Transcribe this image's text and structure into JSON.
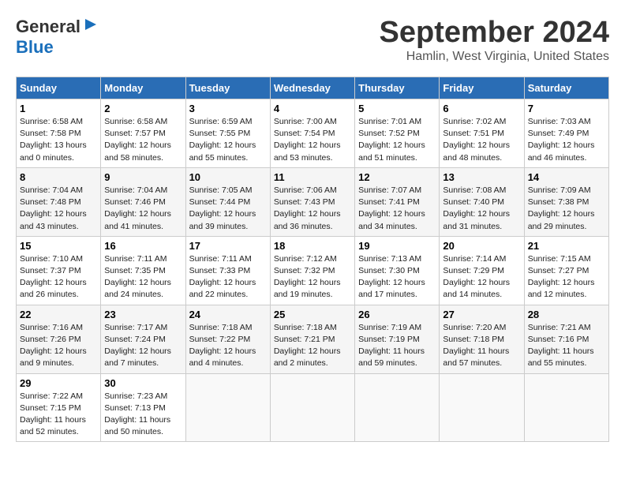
{
  "header": {
    "logo_general": "General",
    "logo_blue": "Blue",
    "month_title": "September 2024",
    "location": "Hamlin, West Virginia, United States"
  },
  "weekdays": [
    "Sunday",
    "Monday",
    "Tuesday",
    "Wednesday",
    "Thursday",
    "Friday",
    "Saturday"
  ],
  "weeks": [
    [
      {
        "day": "1",
        "lines": [
          "Sunrise: 6:58 AM",
          "Sunset: 7:58 PM",
          "Daylight: 13 hours",
          "and 0 minutes."
        ]
      },
      {
        "day": "2",
        "lines": [
          "Sunrise: 6:58 AM",
          "Sunset: 7:57 PM",
          "Daylight: 12 hours",
          "and 58 minutes."
        ]
      },
      {
        "day": "3",
        "lines": [
          "Sunrise: 6:59 AM",
          "Sunset: 7:55 PM",
          "Daylight: 12 hours",
          "and 55 minutes."
        ]
      },
      {
        "day": "4",
        "lines": [
          "Sunrise: 7:00 AM",
          "Sunset: 7:54 PM",
          "Daylight: 12 hours",
          "and 53 minutes."
        ]
      },
      {
        "day": "5",
        "lines": [
          "Sunrise: 7:01 AM",
          "Sunset: 7:52 PM",
          "Daylight: 12 hours",
          "and 51 minutes."
        ]
      },
      {
        "day": "6",
        "lines": [
          "Sunrise: 7:02 AM",
          "Sunset: 7:51 PM",
          "Daylight: 12 hours",
          "and 48 minutes."
        ]
      },
      {
        "day": "7",
        "lines": [
          "Sunrise: 7:03 AM",
          "Sunset: 7:49 PM",
          "Daylight: 12 hours",
          "and 46 minutes."
        ]
      }
    ],
    [
      {
        "day": "8",
        "lines": [
          "Sunrise: 7:04 AM",
          "Sunset: 7:48 PM",
          "Daylight: 12 hours",
          "and 43 minutes."
        ]
      },
      {
        "day": "9",
        "lines": [
          "Sunrise: 7:04 AM",
          "Sunset: 7:46 PM",
          "Daylight: 12 hours",
          "and 41 minutes."
        ]
      },
      {
        "day": "10",
        "lines": [
          "Sunrise: 7:05 AM",
          "Sunset: 7:44 PM",
          "Daylight: 12 hours",
          "and 39 minutes."
        ]
      },
      {
        "day": "11",
        "lines": [
          "Sunrise: 7:06 AM",
          "Sunset: 7:43 PM",
          "Daylight: 12 hours",
          "and 36 minutes."
        ]
      },
      {
        "day": "12",
        "lines": [
          "Sunrise: 7:07 AM",
          "Sunset: 7:41 PM",
          "Daylight: 12 hours",
          "and 34 minutes."
        ]
      },
      {
        "day": "13",
        "lines": [
          "Sunrise: 7:08 AM",
          "Sunset: 7:40 PM",
          "Daylight: 12 hours",
          "and 31 minutes."
        ]
      },
      {
        "day": "14",
        "lines": [
          "Sunrise: 7:09 AM",
          "Sunset: 7:38 PM",
          "Daylight: 12 hours",
          "and 29 minutes."
        ]
      }
    ],
    [
      {
        "day": "15",
        "lines": [
          "Sunrise: 7:10 AM",
          "Sunset: 7:37 PM",
          "Daylight: 12 hours",
          "and 26 minutes."
        ]
      },
      {
        "day": "16",
        "lines": [
          "Sunrise: 7:11 AM",
          "Sunset: 7:35 PM",
          "Daylight: 12 hours",
          "and 24 minutes."
        ]
      },
      {
        "day": "17",
        "lines": [
          "Sunrise: 7:11 AM",
          "Sunset: 7:33 PM",
          "Daylight: 12 hours",
          "and 22 minutes."
        ]
      },
      {
        "day": "18",
        "lines": [
          "Sunrise: 7:12 AM",
          "Sunset: 7:32 PM",
          "Daylight: 12 hours",
          "and 19 minutes."
        ]
      },
      {
        "day": "19",
        "lines": [
          "Sunrise: 7:13 AM",
          "Sunset: 7:30 PM",
          "Daylight: 12 hours",
          "and 17 minutes."
        ]
      },
      {
        "day": "20",
        "lines": [
          "Sunrise: 7:14 AM",
          "Sunset: 7:29 PM",
          "Daylight: 12 hours",
          "and 14 minutes."
        ]
      },
      {
        "day": "21",
        "lines": [
          "Sunrise: 7:15 AM",
          "Sunset: 7:27 PM",
          "Daylight: 12 hours",
          "and 12 minutes."
        ]
      }
    ],
    [
      {
        "day": "22",
        "lines": [
          "Sunrise: 7:16 AM",
          "Sunset: 7:26 PM",
          "Daylight: 12 hours",
          "and 9 minutes."
        ]
      },
      {
        "day": "23",
        "lines": [
          "Sunrise: 7:17 AM",
          "Sunset: 7:24 PM",
          "Daylight: 12 hours",
          "and 7 minutes."
        ]
      },
      {
        "day": "24",
        "lines": [
          "Sunrise: 7:18 AM",
          "Sunset: 7:22 PM",
          "Daylight: 12 hours",
          "and 4 minutes."
        ]
      },
      {
        "day": "25",
        "lines": [
          "Sunrise: 7:18 AM",
          "Sunset: 7:21 PM",
          "Daylight: 12 hours",
          "and 2 minutes."
        ]
      },
      {
        "day": "26",
        "lines": [
          "Sunrise: 7:19 AM",
          "Sunset: 7:19 PM",
          "Daylight: 11 hours",
          "and 59 minutes."
        ]
      },
      {
        "day": "27",
        "lines": [
          "Sunrise: 7:20 AM",
          "Sunset: 7:18 PM",
          "Daylight: 11 hours",
          "and 57 minutes."
        ]
      },
      {
        "day": "28",
        "lines": [
          "Sunrise: 7:21 AM",
          "Sunset: 7:16 PM",
          "Daylight: 11 hours",
          "and 55 minutes."
        ]
      }
    ],
    [
      {
        "day": "29",
        "lines": [
          "Sunrise: 7:22 AM",
          "Sunset: 7:15 PM",
          "Daylight: 11 hours",
          "and 52 minutes."
        ]
      },
      {
        "day": "30",
        "lines": [
          "Sunrise: 7:23 AM",
          "Sunset: 7:13 PM",
          "Daylight: 11 hours",
          "and 50 minutes."
        ]
      },
      null,
      null,
      null,
      null,
      null
    ]
  ]
}
